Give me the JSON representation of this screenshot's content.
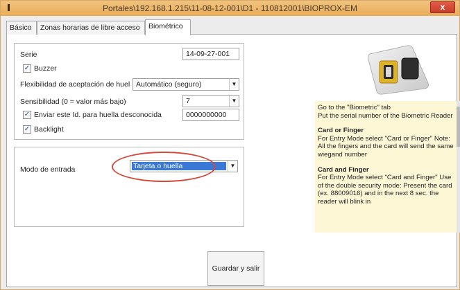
{
  "window": {
    "title": "Portales\\192.168.1.215\\11-08-12-001\\D1 - 110812001\\BIOPROX-EM",
    "close_label": "x"
  },
  "tabs": [
    {
      "label": "Básico"
    },
    {
      "label": "Zonas horarias de libre acceso"
    },
    {
      "label": "Biométrico"
    }
  ],
  "settings": {
    "serie_label": "Serie",
    "serie_value": "14-09-27-001",
    "buzzer_label": "Buzzer",
    "buzzer_checked": true,
    "flex_label": "Flexibilidad de aceptación de huel",
    "flex_value": "Automático (seguro)",
    "sens_label": "Sensibilidad (0 = valor más bajo)",
    "sens_value": "7",
    "unknown_label": "Enviar este Id. para huella desconocida",
    "unknown_checked": true,
    "unknown_value": "0000000000",
    "backlight_label": "Backlight",
    "backlight_checked": true
  },
  "entry": {
    "label": "Modo de entrada",
    "value": "Tarjeta o huella"
  },
  "help": {
    "intro_1": "Go to the \"Biometric\" tab",
    "intro_2": "Put the serial number of the Biometric Reader",
    "h1": "Card or Finger",
    "p1": "For Entry Mode select \"Card or Finger\" Note: All the fingers and the card will send the same wiegand number",
    "h2": "Card and Finger",
    "p2": "For Entry Mode select \"Card and Finger\" Use of the double security mode: Present the card (ex. 88009016) and in the next 8 sec. the reader will blink in"
  },
  "buttons": {
    "save": "Guardar y salir"
  },
  "colors": {
    "titlebar": "#e9ad5a",
    "selection": "#3a78d8",
    "highlight_oval": "#d54a3a",
    "help_bg": "#fdf7d6"
  }
}
